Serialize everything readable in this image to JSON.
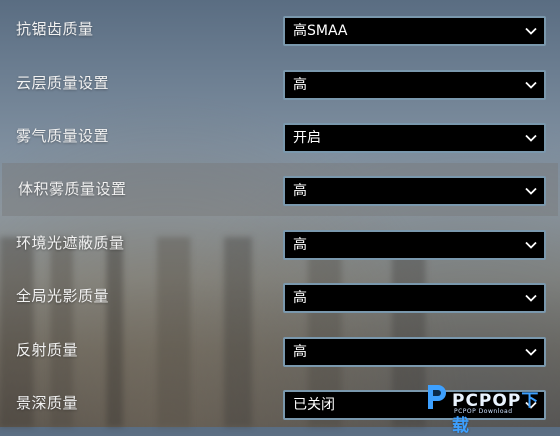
{
  "settings": [
    {
      "label": "抗锯齿质量",
      "value": "高SMAA"
    },
    {
      "label": "云层质量设置",
      "value": "高"
    },
    {
      "label": "雾气质量设置",
      "value": "开启"
    },
    {
      "label": "体积雾质量设置",
      "value": "高"
    },
    {
      "label": "环境光遮蔽质量",
      "value": "高"
    },
    {
      "label": "全局光影质量",
      "value": "高"
    },
    {
      "label": "反射质量",
      "value": "高"
    },
    {
      "label": "景深质量",
      "value": "已关闭"
    }
  ],
  "highlighted_row": 3,
  "watermark": {
    "brand": "PCPOP",
    "brand_cn": "下载",
    "sub": "PCPOP Download"
  },
  "colors": {
    "dropdown_border": "#7a98ad",
    "dropdown_bg": "#000000",
    "label_text": "#f2f2f2",
    "watermark_accent": "#3da0ff"
  },
  "icons": {
    "dropdown": "chevron-down-icon",
    "watermark": "pcpop-logo-icon"
  }
}
